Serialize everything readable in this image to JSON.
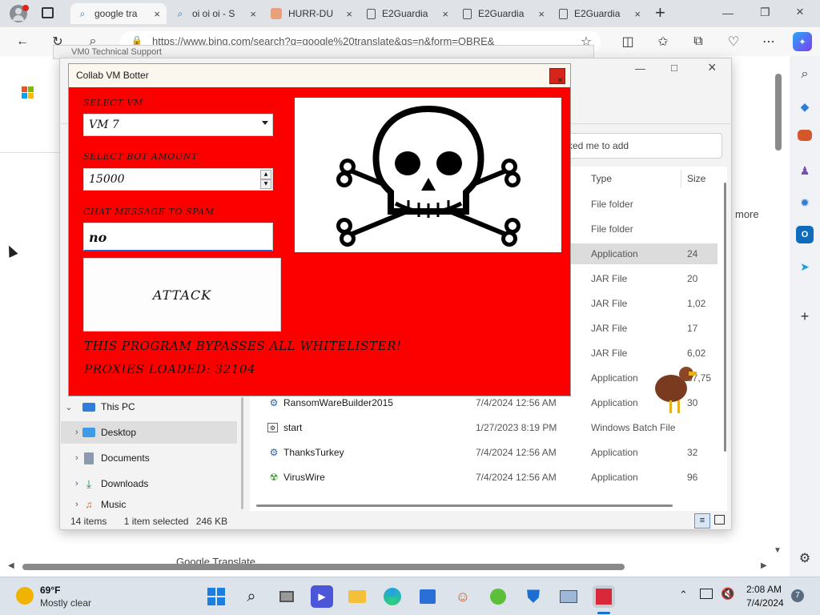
{
  "browser": {
    "tabs": [
      {
        "title": "google tra",
        "icon": "search-icon",
        "active": true
      },
      {
        "title": "oi oi oi - S",
        "icon": "search-icon",
        "active": false
      },
      {
        "title": "HURR-DU",
        "icon": "pig-icon",
        "active": false
      },
      {
        "title": "E2Guardia",
        "icon": "page-icon",
        "active": false
      },
      {
        "title": "E2Guardia",
        "icon": "page-icon",
        "active": false
      },
      {
        "title": "E2Guardia",
        "icon": "page-icon",
        "active": false
      }
    ],
    "new_tab": "+",
    "url": "https://www.bing.com/search?q=google%20translate&qs=n&form=QBRE&",
    "bg_window_title": "VM0 Technical Support"
  },
  "explorer": {
    "share_placeholder": "ked me to add",
    "more_link": "more",
    "columns": {
      "type": "Type",
      "size": "Size"
    },
    "top_rows": [
      {
        "type": "File folder",
        "size": ""
      },
      {
        "type": "File folder",
        "size": ""
      },
      {
        "type": "Application",
        "size": "24"
      },
      {
        "type": "JAR File",
        "size": "20"
      },
      {
        "type": "JAR File",
        "size": "1,02"
      },
      {
        "type": "JAR File",
        "size": "17"
      },
      {
        "type": "JAR File",
        "size": "6,02"
      },
      {
        "type": "Application",
        "size": "67,75"
      }
    ],
    "files": [
      {
        "name": "RansomWareBuilder2015",
        "date": "7/4/2024 12:56 AM",
        "type": "Application",
        "size": "30"
      },
      {
        "name": "start",
        "date": "1/27/2023 8:19 PM",
        "type": "Windows Batch File",
        "size": ""
      },
      {
        "name": "ThanksTurkey",
        "date": "7/4/2024 12:56 AM",
        "type": "Application",
        "size": "32"
      },
      {
        "name": "VirusWire",
        "date": "7/4/2024 12:56 AM",
        "type": "Application",
        "size": "96"
      }
    ],
    "nav": [
      {
        "label": "This PC",
        "expanded": true
      },
      {
        "label": "Desktop",
        "expanded": false
      },
      {
        "label": "Documents",
        "expanded": false
      },
      {
        "label": "Downloads",
        "expanded": false
      },
      {
        "label": "Music",
        "expanded": false
      }
    ],
    "status": {
      "items": "14 items",
      "selected": "1 item selected",
      "size": "246 KB"
    }
  },
  "bot": {
    "title": "Collab VM Botter",
    "close": "×",
    "vm_label": "SELECT VM",
    "vm_value": "VM 7",
    "amount_label": "SELECT BOT AMOUNT",
    "amount_value": "15000",
    "chat_label": "CHAT MESSAGE TO SPAM",
    "chat_value": "no",
    "attack_label": "ATTACK",
    "bypass_text": "THIS PROGRAM BYPASSES ALL WHITELISTER!",
    "proxies_text": "PROXIES LOADED: 32104"
  },
  "page_footer": "Google Translate",
  "taskbar": {
    "weather_temp": "69°F",
    "weather_desc": "Mostly clear",
    "time": "2:08 AM",
    "date": "7/4/2024",
    "notif_count": "7"
  }
}
